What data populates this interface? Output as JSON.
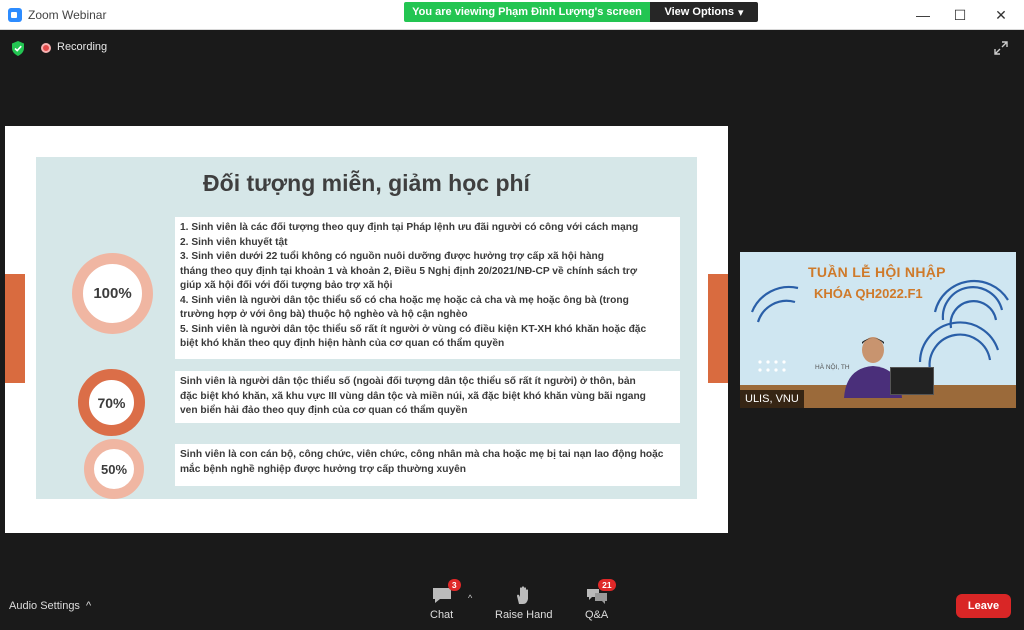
{
  "window": {
    "title": "Zoom Webinar",
    "minimize_glyph": "—",
    "maximize_glyph": "☐",
    "close_glyph": "✕"
  },
  "share_banner": {
    "message": "You are viewing Phạm Đình Lượng's screen",
    "view_options": "View Options",
    "view_options_caret": "▾"
  },
  "status": {
    "recording_label": "Recording"
  },
  "slide": {
    "title": "Đối tượng miễn, giảm học phí",
    "rings": [
      "100%",
      "70%",
      "50%"
    ],
    "box1_lines": [
      "1. Sinh viên là các đối tượng theo quy định tại Pháp lệnh ưu đãi người có công với cách mạng",
      "2. Sinh viên khuyết tật",
      "3. Sinh viên dưới 22 tuổi không có nguồn nuôi dưỡng được hưởng trợ cấp xã hội hàng",
      "tháng theo quy định tại khoản 1  và khoản 2, Điều 5 Nghị định 20/2021/NĐ-CP về chính sách trợ",
      "giúp xã hội đối với đối tượng bảo trợ xã hội",
      "4. Sinh viên là người dân tộc thiểu số có cha hoặc mẹ hoặc cả cha và mẹ hoặc ông bà (trong",
      "trường hợp ở với ông bà) thuộc hộ nghèo và hộ cận nghèo",
      "5. Sinh viên là người dân tộc thiểu số rất ít người ở vùng có điều kiện KT-XH khó khăn hoặc đặc",
      "biệt khó khăn theo quy định hiện hành của cơ quan có thẩm quyền"
    ],
    "box2_lines": [
      "Sinh viên là người dân tộc thiểu số (ngoài đối tượng dân tộc thiểu số rất ít người) ở thôn, bản",
      "đặc biệt khó khăn, xã khu vực III vùng dân tộc và miền núi, xã đặc  biệt khó khăn vùng bãi ngang",
      "ven biển hải đảo theo quy định  của cơ quan có thẩm quyền"
    ],
    "box3_lines": [
      "Sinh viên là con cán bộ, công chức, viên chức, công nhân mà cha hoặc mẹ bị tai nạn lao động hoặc",
      "mắc bệnh nghề nghiệp được hưởng trợ cấp thường xuyên"
    ]
  },
  "video": {
    "banner_line1": "TUẦN LỄ HỘI NHẬP",
    "banner_line2": "KHÓA QH2022.F1",
    "location_fragment": "HÀ NỘI, TH",
    "participant_name": "ULIS, VNU"
  },
  "toolbar": {
    "audio_settings": "Audio Settings",
    "audio_caret": "^",
    "chat_label": "Chat",
    "chat_badge": "3",
    "chat_caret": "^",
    "raise_hand_label": "Raise Hand",
    "qa_label": "Q&A",
    "qa_badge": "21",
    "leave_label": "Leave"
  },
  "colors": {
    "banner_green": "#23c552",
    "accent_orange": "#d96b3f",
    "ring_light": "#f0b6a2",
    "ring_dark": "#db6e48",
    "panel_teal": "#d6e7e8",
    "leave_red": "#d92626",
    "badge_red": "#e02828",
    "title_orange": "#cf7a2a"
  },
  "icons": [
    "zoom-app-icon",
    "shield-check-icon",
    "recording-dot-icon",
    "expand-icon",
    "chat-icon",
    "raise-hand-icon",
    "qa-icon"
  ]
}
